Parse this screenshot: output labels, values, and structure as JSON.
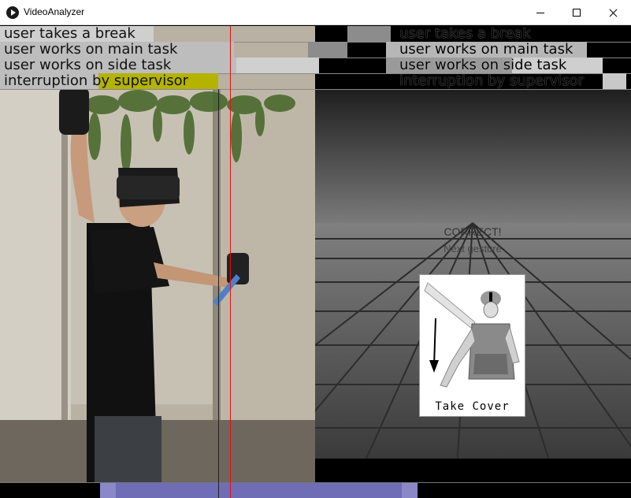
{
  "window": {
    "title": "VideoAnalyzer"
  },
  "annotations": [
    {
      "label": "user takes a break",
      "right_label": "user takes a break"
    },
    {
      "label": "user works on main task",
      "right_label": "user works on main task"
    },
    {
      "label": "user works on side task",
      "right_label": "user works on side task"
    },
    {
      "label": "interruption by supervisor",
      "right_label": "interruption by supervisor"
    }
  ],
  "vr_scene": {
    "feedback": "CORRECT!",
    "next": "Next gesture",
    "gesture_card_label": "Take Cover"
  },
  "colors": {
    "active_segment": "#c8c8c8",
    "inactive_segment": "#8c8c8c",
    "supervisor_highlight": "#b3b300",
    "playhead": "#e01010",
    "timeline_range": "#8a88c9"
  }
}
